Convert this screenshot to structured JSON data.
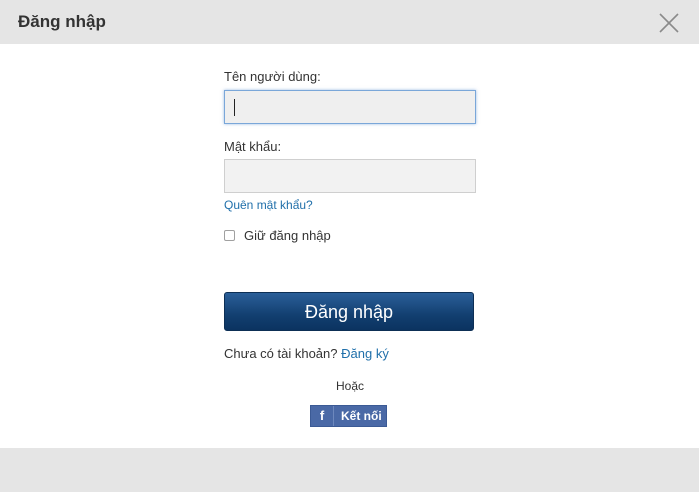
{
  "header": {
    "title": "Đăng nhập"
  },
  "form": {
    "username_label": "Tên người dùng:",
    "username_value": "",
    "password_label": "Mật khẩu:",
    "password_value": "",
    "forgot_link": "Quên mật khẩu?",
    "remember_label": "Giữ đăng nhập",
    "remember_checked": false,
    "submit_label": "Đăng nhập",
    "no_account_text": "Chưa có tài khoản?",
    "signup_link": "Đăng ký",
    "or_text": "Hoặc",
    "facebook_icon": "f",
    "facebook_label": "Kết nối"
  },
  "colors": {
    "header_bg": "#e5e5e5",
    "button_bg": "#123f70",
    "link": "#1f6faa",
    "facebook": "#4a69a6"
  }
}
